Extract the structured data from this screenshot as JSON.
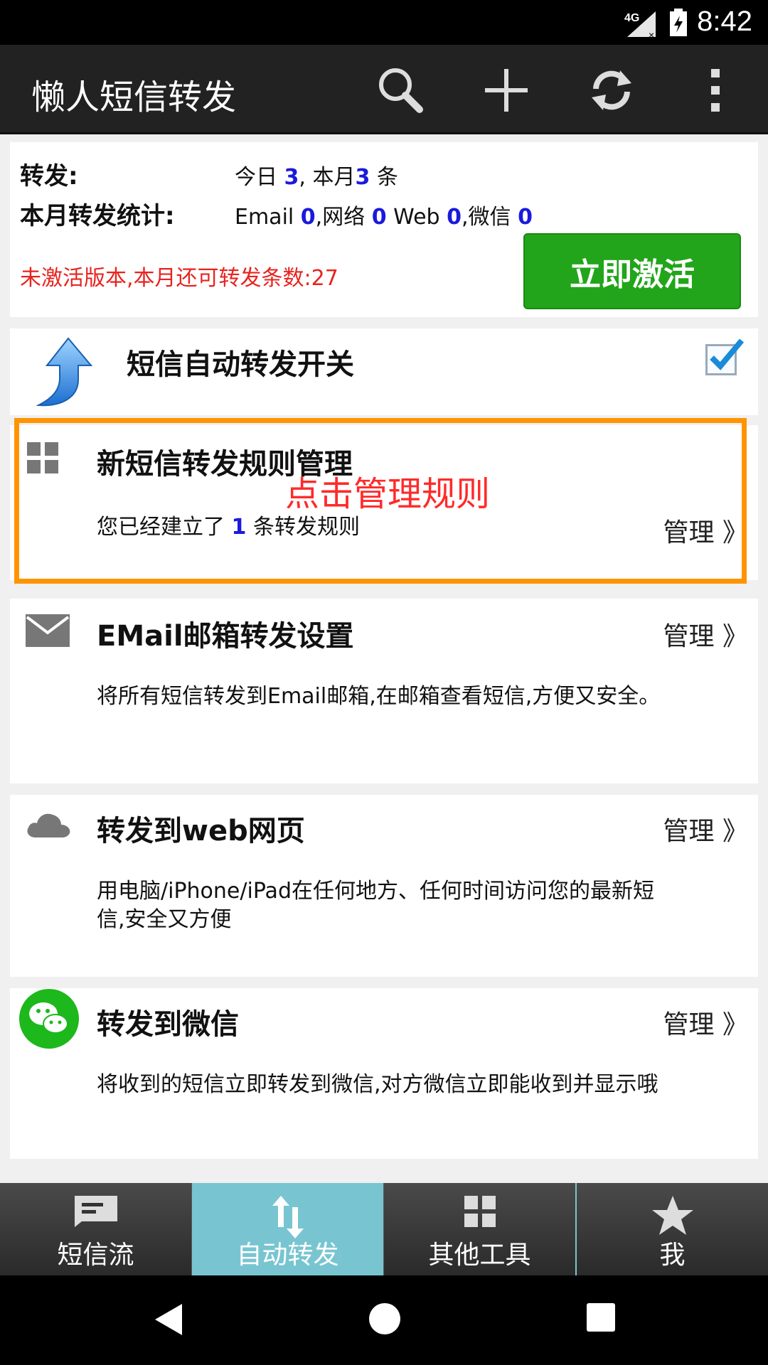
{
  "status_bar": {
    "time": "8:42",
    "network": "4G"
  },
  "app_bar": {
    "title": "懒人短信转发",
    "icons": [
      "search-icon",
      "add-icon",
      "refresh-icon",
      "more-vert-icon"
    ]
  },
  "stats": {
    "forward_label": "转发:",
    "forward_today_prefix": "今日",
    "forward_today": "3",
    "forward_month_sep": ",  本月",
    "forward_month": "3",
    "forward_unit": "条",
    "monthly_label": "本月转发统计:",
    "email_label": "Email",
    "email_count": "0",
    "net_label": ",网络",
    "net_count": "0",
    "web_label": "Web",
    "web_count": "0",
    "wx_label": ",微信",
    "wx_count": "0",
    "warning": "未激活版本,本月还可转发条数:27",
    "activate_button": "立即激活"
  },
  "auto_forward": {
    "label": "短信自动转发开关",
    "checked": true
  },
  "rules": {
    "title": "新短信转发规则管理",
    "hint": "点击管理规则",
    "desc_prefix": "您已经建立了",
    "count": "1",
    "desc_suffix": "条转发规则",
    "manage": "管理 》"
  },
  "email": {
    "title": "EMail邮箱转发设置",
    "desc": "将所有短信转发到Email邮箱,在邮箱查看短信,方便又安全。",
    "manage": "管理 》"
  },
  "web": {
    "title": "转发到web网页",
    "desc": "用电脑/iPhone/iPad在任何地方、任何时间访问您的最新短信,安全又方便",
    "manage": "管理 》"
  },
  "wechat": {
    "title": "转发到微信",
    "desc": "将收到的短信立即转发到微信,对方微信立即能收到并显示哦",
    "manage": "管理 》"
  },
  "tabs": [
    {
      "label": "短信流",
      "active": false
    },
    {
      "label": "自动转发",
      "active": true
    },
    {
      "label": "其他工具",
      "active": false
    },
    {
      "label": "我",
      "active": false
    }
  ],
  "colors": {
    "accent_blue": "#1a1adc",
    "warning_red": "#e8231f",
    "activate_green": "#22a51a",
    "highlight_orange": "#ff9400",
    "active_tab": "#78c5d1"
  }
}
